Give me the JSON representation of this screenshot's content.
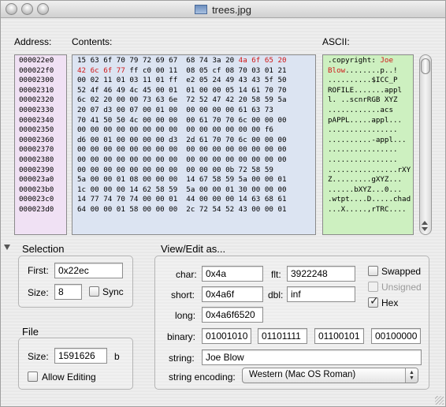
{
  "window": {
    "title": "trees.jpg"
  },
  "headers": {
    "address": "Address:",
    "contents": "Contents:",
    "ascii": "ASCII:"
  },
  "addresses": [
    "000022e0",
    "000022f0",
    "00002300",
    "00002310",
    "00002320",
    "00002330",
    "00002340",
    "00002350",
    "00002360",
    "00002370",
    "00002380",
    "00002390",
    "000023a0",
    "000023b0",
    "000023c0",
    "000023d0"
  ],
  "hex_rows": [
    [
      [
        "15 63 6f 70 79 72 69 67  68 74 3a 20 ",
        false
      ],
      [
        "4a 6f 65 20",
        true
      ]
    ],
    [
      [
        "42 6c 6f 77",
        true
      ],
      [
        " ff c0 00 11  08 05 cf 08 70 03 01 21",
        false
      ]
    ],
    [
      [
        "00 02 11 01 03 11 01 ff  e2 05 24 49 43 43 5f 50",
        false
      ]
    ],
    [
      [
        "52 4f 46 49 4c 45 00 01  01 00 00 05 14 61 70 70",
        false
      ]
    ],
    [
      [
        "6c 02 20 00 00 73 63 6e  72 52 47 42 20 58 59 5a",
        false
      ]
    ],
    [
      [
        "20 07 d3 00 07 00 01 00  00 00 00 00 61 63 73",
        false
      ]
    ],
    [
      [
        "70 41 50 50 4c 00 00 00  00 61 70 70 6c 00 00 00",
        false
      ]
    ],
    [
      [
        "00 00 00 00 00 00 00 00  00 00 00 00 00 00 f6",
        false
      ]
    ],
    [
      [
        "d6 00 01 00 00 00 00 d3  2d 61 70 70 6c 00 00 00",
        false
      ]
    ],
    [
      [
        "00 00 00 00 00 00 00 00  00 00 00 00 00 00 00 00",
        false
      ]
    ],
    [
      [
        "00 00 00 00 00 00 00 00  00 00 00 00 00 00 00 00",
        false
      ]
    ],
    [
      [
        "00 00 00 00 00 00 00 00  00 00 00 0b 72 58 59",
        false
      ]
    ],
    [
      [
        "5a 00 00 01 08 00 00 00  14 67 58 59 5a 00 00 01",
        false
      ]
    ],
    [
      [
        "1c 00 00 00 14 62 58 59  5a 00 00 01 30 00 00 00",
        false
      ]
    ],
    [
      [
        "14 77 74 70 74 00 00 01  44 00 00 00 14 63 68 61",
        false
      ]
    ],
    [
      [
        "64 00 00 01 58 00 00 00  2c 72 54 52 43 00 00 01",
        false
      ]
    ]
  ],
  "ascii_rows": [
    [
      [
        ".copyright: ",
        false
      ],
      [
        "Joe",
        true
      ]
    ],
    [
      [
        "Blow",
        true
      ],
      [
        "........p..!",
        false
      ]
    ],
    [
      [
        "..........$ICC_P",
        false
      ]
    ],
    [
      [
        "ROFILE.......appl",
        false
      ]
    ],
    [
      [
        "l. ..scnrRGB XYZ",
        false
      ]
    ],
    [
      [
        "............acs",
        false
      ]
    ],
    [
      [
        "pAPPL.....appl...",
        false
      ]
    ],
    [
      [
        "................",
        false
      ]
    ],
    [
      [
        "..........-appl...",
        false
      ]
    ],
    [
      [
        "................",
        false
      ]
    ],
    [
      [
        "................",
        false
      ]
    ],
    [
      [
        "................rXY",
        false
      ]
    ],
    [
      [
        "Z.........gXYZ...",
        false
      ]
    ],
    [
      [
        "......bXYZ...0...",
        false
      ]
    ],
    [
      [
        ".wtpt....D.....chad",
        false
      ]
    ],
    [
      [
        "...X.....,rTRC....",
        false
      ]
    ]
  ],
  "selection": {
    "title": "Selection",
    "first_label": "First:",
    "first_value": "0x22ec",
    "size_label": "Size:",
    "size_value": "8",
    "sync_label": "Sync"
  },
  "file": {
    "title": "File",
    "size_label": "Size:",
    "size_value": "1591626",
    "unit": "b",
    "allow_editing_label": "Allow Editing"
  },
  "view_edit": {
    "title": "View/Edit as...",
    "char_label": "char:",
    "char_value": "0x4a",
    "flt_label": "flt:",
    "flt_value": "3922248",
    "short_label": "short:",
    "short_value": "0x4a6f",
    "dbl_label": "dbl:",
    "dbl_value": "inf",
    "long_label": "long:",
    "long_value": "0x4a6f6520",
    "swapped_label": "Swapped",
    "unsigned_label": "Unsigned",
    "hex_label": "Hex",
    "binary_label": "binary:",
    "binary_values": [
      "01001010",
      "01101111",
      "01100101",
      "00100000"
    ],
    "string_label": "string:",
    "string_value": "Joe Blow",
    "encoding_label": "string encoding:",
    "encoding_value": "Western (Mac OS Roman)"
  },
  "colors": {
    "address_bg": "#f0e1f4",
    "contents_bg": "#dce4f2",
    "ascii_bg": "#cdf0c0",
    "highlight": "#d01818"
  }
}
